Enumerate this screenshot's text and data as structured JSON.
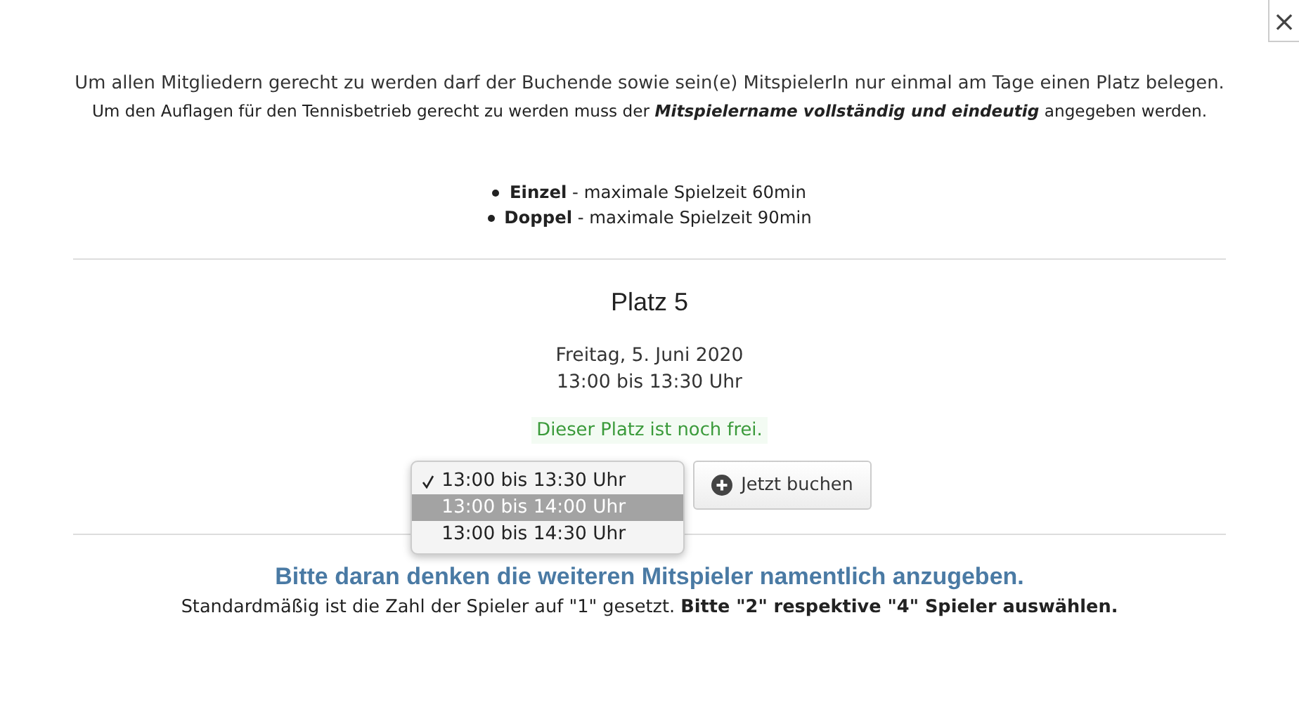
{
  "close_button": {
    "label": "×"
  },
  "intro": [
    "Um allen Mitgliedern gerecht zu werden darf der Buchende sowie sein(e) MitspielerIn nur einmal am Tage einen Platz belegen.",
    "Um den Auflagen für den Tennisbetrieb gerecht zu werden muss der "
  ],
  "intro_emphasis": "Mitspielername vollständig und eindeutig",
  "intro_end": " angegeben werden.",
  "rules": [
    {
      "name": "Einzel",
      "text": " - maximale Spielzeit 60min"
    },
    {
      "name": "Doppel",
      "text": " - maximale Spielzeit 90min"
    }
  ],
  "court": {
    "title": "Platz 5",
    "date": "Freitag, 5. Juni 2020",
    "time": "13:00 bis 13:30 Uhr",
    "status": "Dieser Platz ist noch frei."
  },
  "duration_dropdown": {
    "expanded": true,
    "options": [
      {
        "label": "13:00 bis 13:30 Uhr",
        "checked": true,
        "selected": false
      },
      {
        "label": "13:00 bis 14:00 Uhr",
        "checked": false,
        "selected": true
      },
      {
        "label": "13:00 bis 14:30 Uhr",
        "checked": false,
        "selected": false
      }
    ]
  },
  "book_button": {
    "label": "Jetzt buchen"
  },
  "reminder": {
    "heading": "Bitte daran denken die weiteren Mitspieler namentlich anzugeben.",
    "text": "Standardmäßig ist die Zahl der Spieler auf \"1\" gesetzt. **Bitte \"2\" respektive \"4\" Spieler auswählen.**"
  }
}
